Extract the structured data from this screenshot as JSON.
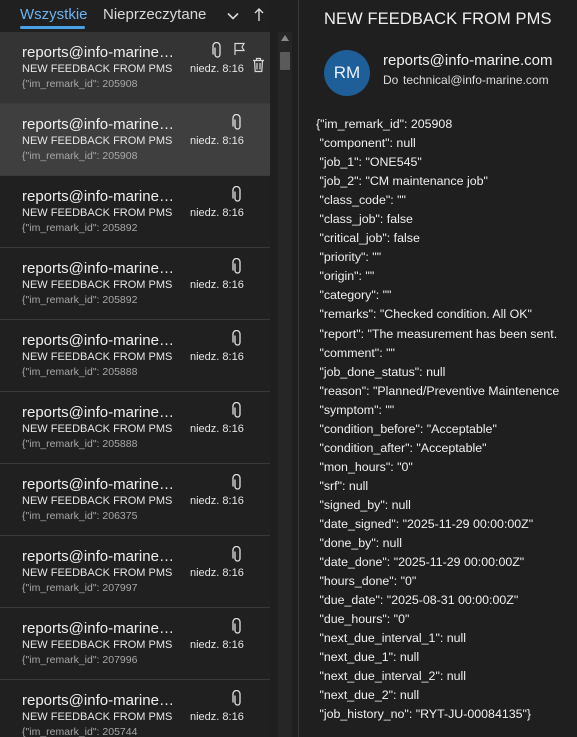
{
  "tabs": {
    "all": "Wszystkie",
    "unread": "Nieprzeczytane"
  },
  "messages": [
    {
      "from": "reports@info-marine…",
      "subject": "NEW FEEDBACK FROM PMS",
      "date": "niedz. 8:16",
      "preview": "{\"im_remark_id\": 205908",
      "state": "hover"
    },
    {
      "from": "reports@info-marine…",
      "subject": "NEW FEEDBACK FROM PMS",
      "date": "niedz. 8:16",
      "preview": "{\"im_remark_id\": 205908",
      "state": "selected"
    },
    {
      "from": "reports@info-marine…",
      "subject": "NEW FEEDBACK FROM PMS",
      "date": "niedz. 8:16",
      "preview": "{\"im_remark_id\": 205892",
      "state": ""
    },
    {
      "from": "reports@info-marine…",
      "subject": "NEW FEEDBACK FROM PMS",
      "date": "niedz. 8:16",
      "preview": "{\"im_remark_id\": 205892",
      "state": ""
    },
    {
      "from": "reports@info-marine…",
      "subject": "NEW FEEDBACK FROM PMS",
      "date": "niedz. 8:16",
      "preview": "{\"im_remark_id\": 205888",
      "state": ""
    },
    {
      "from": "reports@info-marine…",
      "subject": "NEW FEEDBACK FROM PMS",
      "date": "niedz. 8:16",
      "preview": "{\"im_remark_id\": 205888",
      "state": ""
    },
    {
      "from": "reports@info-marine…",
      "subject": "NEW FEEDBACK FROM PMS",
      "date": "niedz. 8:16",
      "preview": "{\"im_remark_id\": 206375",
      "state": ""
    },
    {
      "from": "reports@info-marine…",
      "subject": "NEW FEEDBACK FROM PMS",
      "date": "niedz. 8:16",
      "preview": "{\"im_remark_id\": 207997",
      "state": ""
    },
    {
      "from": "reports@info-marine…",
      "subject": "NEW FEEDBACK FROM PMS",
      "date": "niedz. 8:16",
      "preview": "{\"im_remark_id\": 207996",
      "state": ""
    },
    {
      "from": "reports@info-marine…",
      "subject": "NEW FEEDBACK FROM PMS",
      "date": "niedz. 8:16",
      "preview": "{\"im_remark_id\": 205744",
      "state": ""
    }
  ],
  "reading": {
    "subject": "NEW FEEDBACK FROM PMS",
    "avatar_initials": "RM",
    "avatar_color": "#1e5f9a",
    "sender": "reports@info-marine.com",
    "to_label": "Do",
    "to_address": "technical@info-marine.com",
    "body_lines": [
      "{\"im_remark_id\": 205908",
      " \"component\": null",
      " \"job_1\": \"ONE545\"",
      " \"job_2\": \"CM maintenance job\"",
      " \"class_code\": \"\"",
      " \"class_job\": false",
      " \"critical_job\": false",
      " \"priority\": \"\"",
      " \"origin\": \"\"",
      " \"category\": \"\"",
      " \"remarks\": \"Checked condition. All OK\"",
      " \"report\": \"The measurement has been sent.",
      " \"comment\": \"\"",
      " \"job_done_status\": null",
      " \"reason\": \"Planned/Preventive Maintenence",
      " \"symptom\": \"\"",
      " \"condition_before\": \"Acceptable\"",
      " \"condition_after\": \"Acceptable\"",
      " \"mon_hours\": \"0\"",
      " \"srf\": null",
      " \"signed_by\": null",
      " \"date_signed\": \"2025-11-29 00:00:00Z\"",
      " \"done_by\": null",
      " \"date_done\": \"2025-11-29 00:00:00Z\"",
      " \"hours_done\": \"0\"",
      " \"due_date\": \"2025-08-31 00:00:00Z\"",
      " \"due_hours\": \"0\"",
      " \"next_due_interval_1\": null",
      " \"next_due_1\": null",
      " \"next_due_interval_2\": null",
      " \"next_due_2\": null",
      " \"job_history_no\": \"RYT-JU-00084135\"}"
    ]
  },
  "colors": {
    "accent": "#4aa0e6",
    "background": "#1f1f1f",
    "selected_row": "#3f3f3f"
  }
}
